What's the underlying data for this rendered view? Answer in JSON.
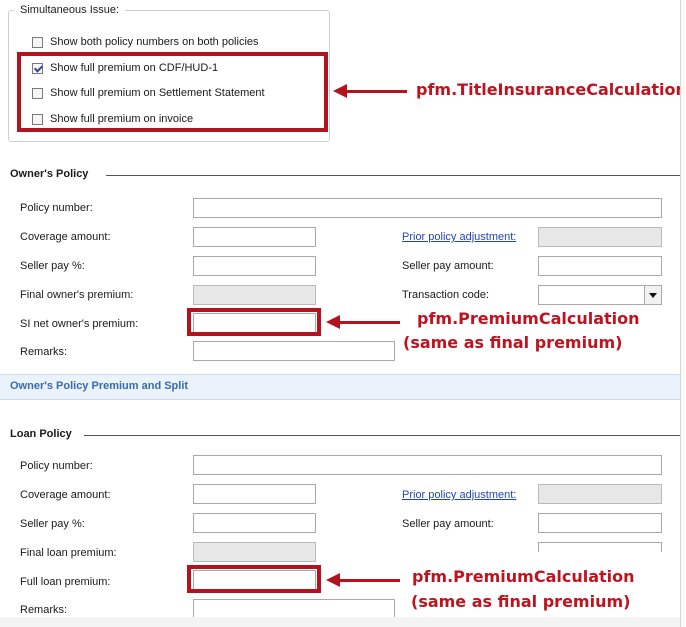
{
  "simultaneous_issue": {
    "title": "Simultaneous Issue:",
    "options": [
      {
        "label": "Show both policy numbers on both policies",
        "checked": false
      },
      {
        "label": "Show full premium on CDF/HUD-1",
        "checked": true
      },
      {
        "label": "Show full premium on Settlement Statement",
        "checked": false
      },
      {
        "label": "Show full premium on invoice",
        "checked": false
      }
    ]
  },
  "annotations": {
    "title_insurance": "pfm.TitleInsuranceCalculation",
    "premium_calc_1": "pfm.PremiumCalculation",
    "premium_calc_1_note": "(same as final premium)",
    "premium_calc_2": "pfm.PremiumCalculation",
    "premium_calc_2_note": "(same as final premium)"
  },
  "owners_policy": {
    "title": "Owner's Policy",
    "policy_number": "Policy number:",
    "coverage_amount": "Coverage amount:",
    "prior_policy_adjustment": "Prior policy adjustment:",
    "seller_pay_pct": "Seller pay %:",
    "seller_pay_amount": "Seller pay amount:",
    "final_premium": "Final owner's premium:",
    "transaction_code": "Transaction code:",
    "si_net_premium": "SI net owner's premium:",
    "remarks": "Remarks:"
  },
  "split_section": {
    "title": "Owner's Policy Premium and Split"
  },
  "loan_policy": {
    "title": "Loan Policy",
    "policy_number": "Policy number:",
    "coverage_amount": "Coverage amount:",
    "prior_policy_adjustment": "Prior policy adjustment:",
    "seller_pay_pct": "Seller pay %:",
    "seller_pay_amount": "Seller pay amount:",
    "final_premium": "Final loan premium:",
    "full_premium": "Full loan premium:",
    "remarks": "Remarks:"
  },
  "colors": {
    "annotation_red": "#b3121f",
    "link_blue": "#2146b8",
    "section_bar": "#eaf2fb"
  }
}
